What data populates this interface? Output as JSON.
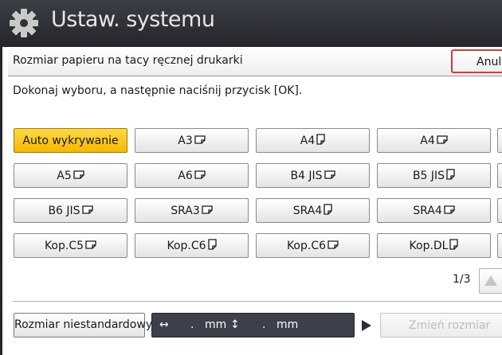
{
  "window": {
    "title": "Ustaw. systemu",
    "icon": "gear-icon"
  },
  "header": {
    "title": "Rozmiar papieru na tacy ręcznej drukarki",
    "cancel_label": "Anulu"
  },
  "instruction": "Dokonaj wyboru, a następnie naciśnij przycisk [OK].",
  "sizes": [
    [
      "Auto wykrywanie",
      "A3",
      "A4",
      "A4"
    ],
    [
      "A5",
      "A6",
      "B4 JIS",
      "B5 JIS"
    ],
    [
      "B6 JIS",
      "SRA3",
      "SRA4",
      "SRA4"
    ],
    [
      "Kop.C5",
      "Kop.C6",
      "Kop.C6",
      "Kop.DL"
    ]
  ],
  "size_orientation": [
    [
      "none",
      "landscape",
      "portrait",
      "landscape"
    ],
    [
      "landscape",
      "landscape",
      "landscape",
      "portrait"
    ],
    [
      "landscape",
      "landscape",
      "portrait",
      "landscape"
    ],
    [
      "landscape",
      "portrait",
      "landscape",
      "portrait"
    ]
  ],
  "selected": "Auto wykrywanie",
  "pager": {
    "label": "1/3"
  },
  "custom": {
    "button_label": "Rozmiar niestandardowy",
    "width_arrow": "↔",
    "height_arrow": "↕",
    "width_value": ".",
    "height_value": ".",
    "unit": "mm"
  },
  "change_size_label": "Zmień rozmiar",
  "colors": {
    "title_bar": "#2e3137",
    "selected": "#f7c314",
    "cancel_border": "#d53a3a",
    "dim_field": "#3d404a"
  }
}
